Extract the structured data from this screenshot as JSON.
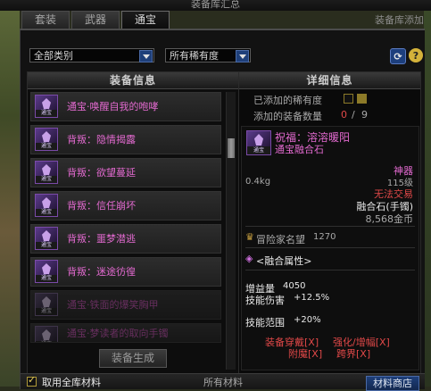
{
  "window": {
    "title": "装备库汇总"
  },
  "tabs": [
    {
      "label": "套装"
    },
    {
      "label": "武器"
    },
    {
      "label": "通宝"
    }
  ],
  "top_right_label": "装备库添加",
  "filters": {
    "category": "全部类别",
    "rarity": "所有稀有度"
  },
  "left_panel": {
    "title": "装备信息",
    "items": [
      {
        "name": "通宝·唤醒自我的咆哮",
        "icon_tag": "通宝"
      },
      {
        "name": "背叛：隐情揭露",
        "icon_tag": "通宝"
      },
      {
        "name": "背叛：欲望蔓延",
        "icon_tag": "通宝"
      },
      {
        "name": "背叛：信任崩坏",
        "icon_tag": "通宝"
      },
      {
        "name": "背叛：噩梦潜逃",
        "icon_tag": "通宝"
      },
      {
        "name": "背叛：迷途彷徨",
        "icon_tag": "通宝"
      },
      {
        "name": "通宝·铁面的爆笑胸甲",
        "icon_tag": "通宝"
      },
      {
        "name": "通宝·梦读者的取向手镯",
        "icon_tag": "通宝"
      }
    ],
    "generate_button": "装备生成"
  },
  "right_panel": {
    "title": "详细信息",
    "added_rarity_label": "已添加的稀有度",
    "added_count_label": "添加的装备数量",
    "added_count": "0",
    "count_sep": "/",
    "max_count": "9",
    "detail": {
      "icon_tag": "通宝",
      "name": "祝福：溶溶暖阳",
      "subtitle": "通宝融合石",
      "rarity": "神器",
      "weight": "0.4kg",
      "level": "115级",
      "trade": "无法交易",
      "slot": "融合石(手镯)",
      "price": "8,568金币",
      "fame_label": "冒险家名望",
      "fame_value": "1270",
      "fusion_label": "<融合属性>",
      "gain_label": "增益量",
      "gain_value": "4050",
      "skill_dmg_label": "技能伤害",
      "skill_dmg_value": "+12.5%",
      "skill_range_label": "技能范围",
      "skill_range_value": "+20%",
      "footer_1a": "装备穿戴[X]",
      "footer_1b": "强化/增幅[X]",
      "footer_2a": "附魔[X]",
      "footer_2b": "跨界[X]"
    }
  },
  "bottom": {
    "use_all_label": "取用全库材料",
    "materials_label": "所有材料",
    "shop_button": "材料商店"
  },
  "colors": {
    "pink": "#e36ad0",
    "red": "#e04848",
    "blue_button": "#1e3f7a"
  }
}
